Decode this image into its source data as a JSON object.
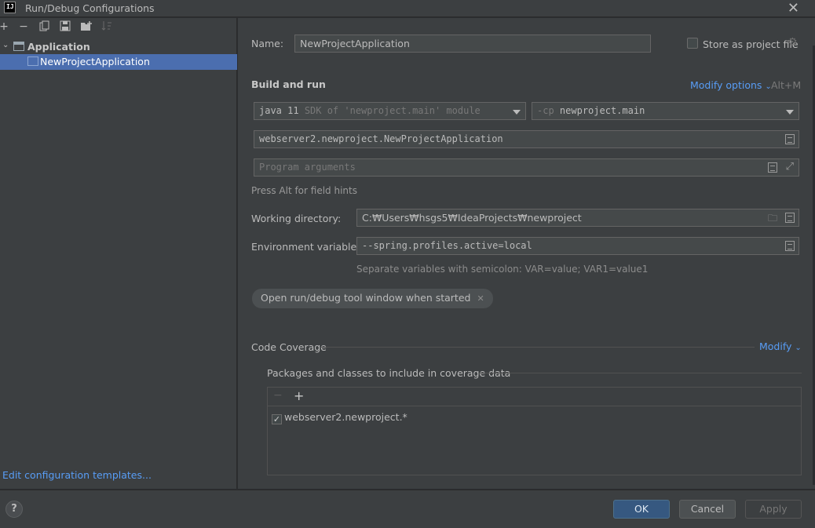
{
  "window": {
    "title": "Run/Debug Configurations",
    "logo_text": "IJ"
  },
  "left": {
    "tree": {
      "group_label": "Application",
      "child_label": "NewProjectApplication"
    },
    "edit_templates": "Edit configuration templates..."
  },
  "form": {
    "name_label": "Name:",
    "name_value": "NewProjectApplication",
    "store_label": "Store as project file",
    "section_title": "Build and run",
    "modify_options": "Modify options",
    "modify_shortcut": "Alt+M",
    "jdk_main": "java 11",
    "jdk_detail": "SDK of 'newproject.main' module",
    "cp_prefix": "-cp",
    "cp_value": "newproject.main",
    "main_class": "webserver2.newproject.NewProjectApplication",
    "program_args_placeholder": "Program arguments",
    "field_hint": "Press Alt for field hints",
    "workdir_label": "Working directory:",
    "workdir_value": "C:₩Users₩hsgs5₩IdeaProjects₩newproject",
    "env_label": "Environment variables:",
    "env_value": "--spring.profiles.active=local",
    "env_hint": "Separate variables with semicolon: VAR=value; VAR1=value1",
    "chip_label": "Open run/debug tool window when started",
    "coverage_title": "Code Coverage",
    "coverage_modify": "Modify",
    "packages_label": "Packages and classes to include in coverage data",
    "coverage_item": "webserver2.newproject.*",
    "coverage_item_checked": true
  },
  "buttons": {
    "help": "?",
    "ok": "OK",
    "cancel": "Cancel",
    "apply": "Apply"
  },
  "colors": {
    "accent": "#589df6",
    "selection": "#4b6eaf",
    "primary_button": "#365880"
  }
}
